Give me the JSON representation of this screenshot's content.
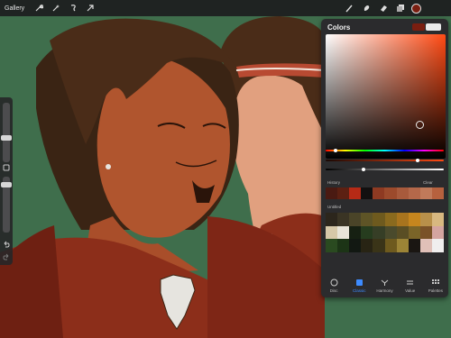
{
  "toolbar": {
    "gallery_label": "Gallery",
    "left_tools": [
      "wrench-icon",
      "magic-wand-icon",
      "selection-icon",
      "transform-arrow-icon"
    ],
    "right_tools": [
      "brush-icon",
      "smudge-icon",
      "eraser-icon",
      "layers-icon"
    ],
    "current_color": "#7a1e10"
  },
  "colors_panel": {
    "title": "Colors",
    "current_color": "#7a1e10",
    "previous_color": "#eaeaea",
    "hue_base": "#ff4a14",
    "history_label": "History",
    "clear_label": "Clear",
    "history": [
      "#4a1a12",
      "#5c2012",
      "#b62a16",
      "#121010",
      "#8e3a22",
      "#9c4a2c",
      "#a85a3c",
      "#b4684a",
      "#c07a5a",
      "#b6613e"
    ],
    "palette_label": "Untitled",
    "palette": [
      "#2c261c",
      "#3a3424",
      "#4a4428",
      "#5e5426",
      "#6e5a1e",
      "#8a6a1e",
      "#a8741e",
      "#c6861e",
      "#b8904a",
      "#d8b880",
      "#d6c8a8",
      "#e8e4d8",
      "#162012",
      "#263c1e",
      "#363e26",
      "#4a4a2c",
      "#5a4e24",
      "#7a6428",
      "#7a5228",
      "#d4a4a0",
      "#2a4a20",
      "#1c3416",
      "#121812",
      "#282414",
      "#3a3418",
      "#6e5a1e",
      "#9c8436",
      "#1a1612",
      "#e0c0b8",
      "#f0eeee"
    ],
    "tabs": [
      {
        "label": "Disc",
        "icon": "disc-icon",
        "active": false
      },
      {
        "label": "Classic",
        "icon": "classic-icon",
        "active": true
      },
      {
        "label": "Harmony",
        "icon": "harmony-icon",
        "active": false
      },
      {
        "label": "Value",
        "icon": "value-icon",
        "active": false
      },
      {
        "label": "Palettes",
        "icon": "palettes-icon",
        "active": false
      }
    ]
  },
  "colors": {
    "background_green": "#3f6e4c",
    "skin_dark": "#b0552e",
    "skin_light": "#e1a07f",
    "hair": "#4a2c18",
    "jacket": "#8c2e1a",
    "active_tab": "#3d8bff"
  }
}
